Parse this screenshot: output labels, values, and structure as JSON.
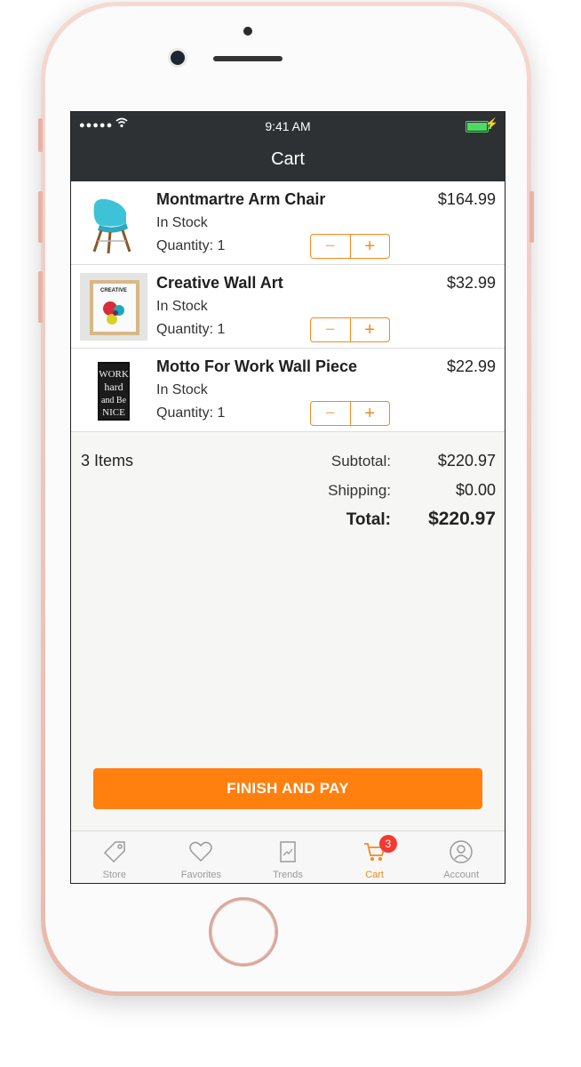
{
  "status_bar": {
    "time": "9:41 AM",
    "signal": "●●●●●"
  },
  "nav": {
    "title": "Cart"
  },
  "cart": {
    "items": [
      {
        "name": "Montmartre Arm Chair",
        "stock": "In Stock",
        "quantity": "Quantity: 1",
        "price": "$164.99"
      },
      {
        "name": "Creative Wall Art",
        "stock": "In Stock",
        "quantity": "Quantity: 1",
        "price": "$32.99"
      },
      {
        "name": "Motto For Work Wall Piece",
        "stock": "In Stock",
        "quantity": "Quantity: 1",
        "price": "$22.99"
      }
    ],
    "stepper": {
      "minus": "−",
      "plus": "+"
    },
    "art_label": "CREATIVE",
    "motto_lines": [
      "WORK",
      "hard",
      "and Be",
      "NICE"
    ]
  },
  "summary": {
    "count": "3 Items",
    "subtotal_label": "Subtotal:",
    "subtotal_value": "$220.97",
    "shipping_label": "Shipping:",
    "shipping_value": "$0.00",
    "total_label": "Total:",
    "total_value": "$220.97"
  },
  "cta": {
    "label": "FINISH AND PAY"
  },
  "tabs": [
    {
      "label": "Store",
      "icon": "tag-icon"
    },
    {
      "label": "Favorites",
      "icon": "heart-icon"
    },
    {
      "label": "Trends",
      "icon": "trends-icon"
    },
    {
      "label": "Cart",
      "icon": "cart-icon",
      "badge": "3",
      "active": true
    },
    {
      "label": "Account",
      "icon": "account-icon"
    }
  ],
  "colors": {
    "accent": "#f28a1c",
    "cta": "#ff7f0f",
    "navbar": "#2d3133",
    "badge": "#f23a30"
  }
}
